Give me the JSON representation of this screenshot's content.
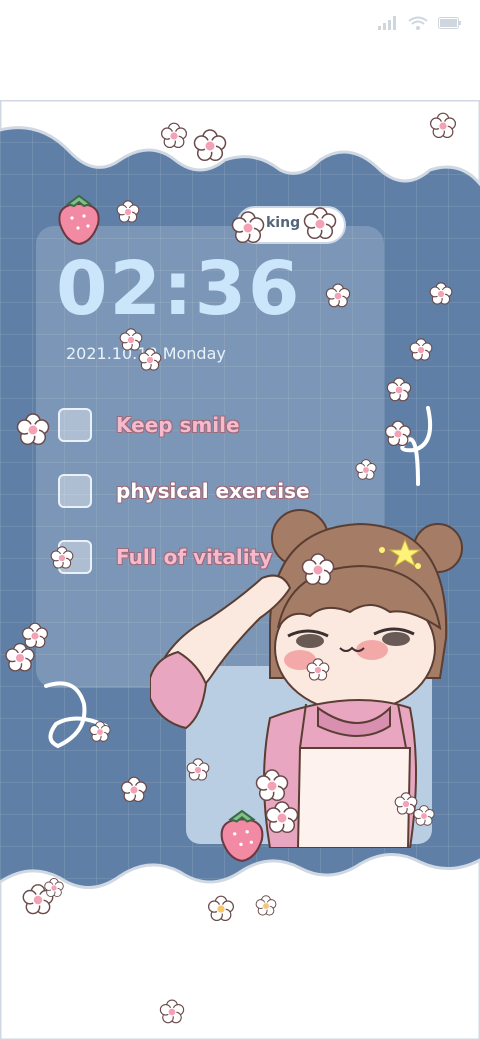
{
  "status": {
    "signal": "signal-icon",
    "wifi": "wifi-icon",
    "battery": "battery-icon"
  },
  "widget": {
    "time": "02:36",
    "date": "2021.10.18 Monday",
    "bubble_text": "king"
  },
  "todos": [
    {
      "label": "Keep smile"
    },
    {
      "label": "physical exercise"
    },
    {
      "label": "Full of vitality"
    }
  ],
  "colors": {
    "background": "#5f7fa6",
    "clock": "#cbe6fb",
    "accent_pink": "#f7b9cc"
  }
}
